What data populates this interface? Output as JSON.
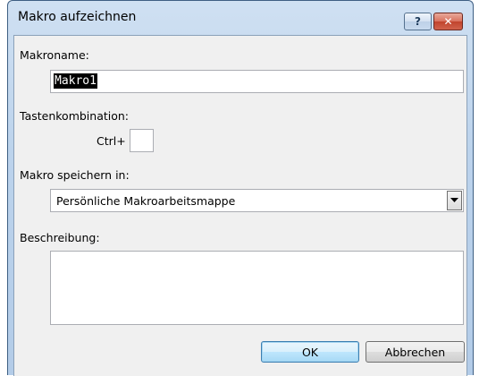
{
  "window": {
    "title": "Makro aufzeichnen",
    "help_glyph": "?",
    "close_glyph": "✕"
  },
  "macro_name": {
    "label": "Makroname:",
    "value": "Makro1"
  },
  "shortcut": {
    "label": "Tastenkombination:",
    "prefix": "Ctrl+",
    "value": ""
  },
  "store_in": {
    "label": "Makro speichern in:",
    "selected": "Persönliche Makroarbeitsmappe"
  },
  "description": {
    "label": "Beschreibung:",
    "value": ""
  },
  "buttons": {
    "ok": "OK",
    "cancel": "Abbrechen"
  },
  "colors": {
    "title_bar": "#bcd3ec",
    "dialog_bg": "#f0f0f0",
    "close_button": "#c1442d",
    "default_button": "#3c7fb1"
  }
}
